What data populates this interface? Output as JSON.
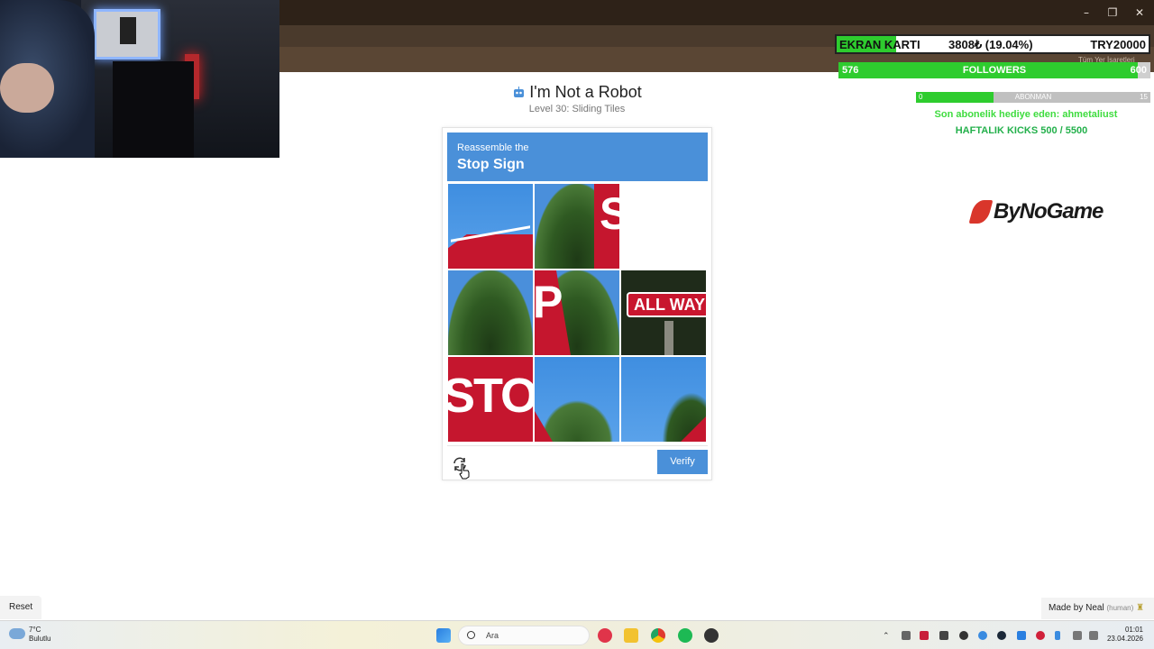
{
  "window": {
    "minimize": "–",
    "maximize": "❐",
    "close": "✕",
    "bookmarks_label": "Tüm Yer İşaretleri"
  },
  "overlay": {
    "goal": {
      "label": "EKRAN KARTI",
      "progress_text": "3808₺ (19.04%)",
      "target": "TRY20000",
      "fraction": 0.19
    },
    "followers": {
      "current": "576",
      "label": "FOLLOWERS",
      "target": "600",
      "fraction": 0.96
    },
    "subs": {
      "current": "0",
      "label": "ABONMAN",
      "target": "15",
      "fraction": 0.33
    },
    "gift_text": "Son abonelik hediye eden: ahmetaliust",
    "kicks_text": "HAFTALIK KICKS 500 / 5500",
    "sponsor": "ByNoGame"
  },
  "page": {
    "title": "I'm Not a Robot",
    "subtitle": "Level 30: Sliding Tiles"
  },
  "captcha": {
    "instruction": "Reassemble the",
    "target": "Stop Sign",
    "verify_label": "Verify",
    "tile_texts": {
      "s": "S",
      "p": "P",
      "stop": "STO",
      "allway": "ALL WAY"
    }
  },
  "footer": {
    "reset_label": "Reset",
    "made_by": "Made by Neal",
    "made_by_note": "(human)"
  },
  "taskbar": {
    "weather_temp": "7°C",
    "weather_desc": "Bulutlu",
    "search_placeholder": "Ara",
    "time": "01:01",
    "date": "23.04.2026"
  },
  "colors": {
    "accent": "#4a90d9",
    "overlay_green": "#2ecc2e",
    "sign_red": "#c5162e"
  }
}
